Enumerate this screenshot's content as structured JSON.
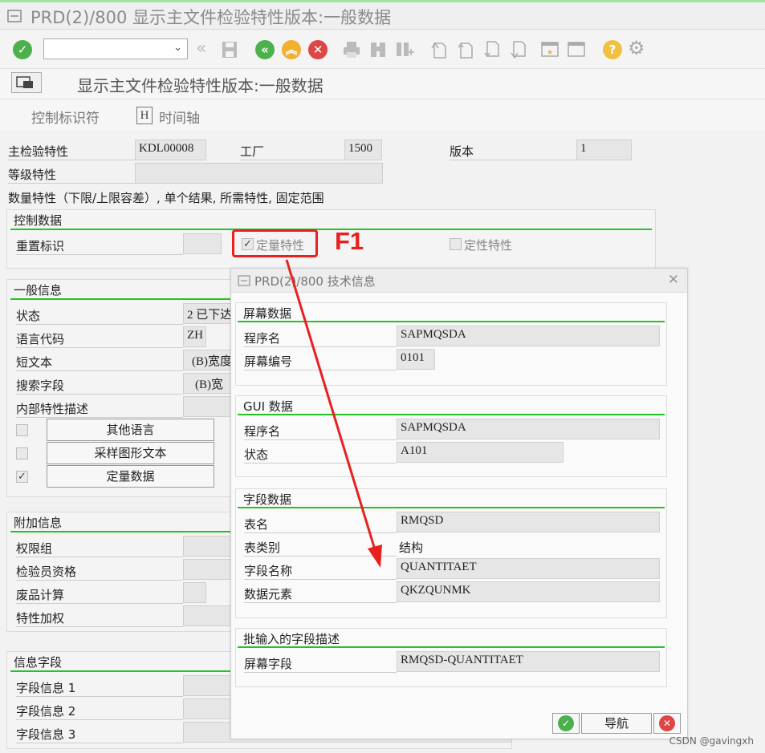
{
  "window": {
    "title": "PRD(2)/800 显示主文件检验特性版本:一般数据"
  },
  "toolbar": {
    "command_field_value": ""
  },
  "screen_title": "显示主文件检验特性版本:一般数据",
  "app_toolbar": {
    "control_indicators": "控制标识符",
    "timeline": "时间轴",
    "timeline_key": "H"
  },
  "header": {
    "master_char_label": "主检验特性",
    "master_char_value": "KDL00008",
    "plant_label": "工厂",
    "plant_value": "1500",
    "version_label": "版本",
    "version_value": "1",
    "class_char_label": "等级特性",
    "class_char_value": "",
    "description": "数量特性（下限/上限容差）, 单个结果, 所需特性, 固定范围"
  },
  "control_data": {
    "title": "控制数据",
    "reset_label": "重置标识",
    "quantitative": "定量特性",
    "quantitative_checked": true,
    "qualitative": "定性特性",
    "qualitative_checked": false
  },
  "general_info": {
    "title": "一般信息",
    "status_label": "状态",
    "status_value": "2 已下达",
    "lang_label": "语言代码",
    "lang_value": "ZH",
    "short_text_label": "短文本",
    "short_text_value": "(B)宽度",
    "search_label": "搜索字段",
    "search_value": "(B)宽",
    "internal_desc_label": "内部特性描述",
    "btn_other_lang": "其他语言",
    "btn_sample_text": "采样图形文本",
    "btn_quant_data": "定量数据",
    "quant_data_checked": true
  },
  "additional_info": {
    "title": "附加信息",
    "authority_label": "权限组",
    "inspector_label": "检验员资格",
    "scrap_label": "废品计算",
    "weighting_label": "特性加权"
  },
  "info_fields": {
    "title": "信息字段",
    "f1": "字段信息 1",
    "f2": "字段信息 2",
    "f3": "字段信息 3"
  },
  "annotation": {
    "key": "F1"
  },
  "dialog": {
    "title": "PRD(2)/800 技术信息",
    "screen_data": {
      "title": "屏幕数据",
      "program_label": "程序名",
      "program_value": "SAPMQSDA",
      "screen_no_label": "屏幕编号",
      "screen_no_value": "0101"
    },
    "gui_data": {
      "title": "GUI 数据",
      "program_label": "程序名",
      "program_value": "SAPMQSDA",
      "status_label": "状态",
      "status_value": "A101"
    },
    "field_data": {
      "title": "字段数据",
      "table_label": "表名",
      "table_value": "RMQSD",
      "table_type_label": "表类别",
      "table_type_value": "结构",
      "field_name_label": "字段名称",
      "field_name_value": "QUANTITAET",
      "data_element_label": "数据元素",
      "data_element_value": "QKZQUNMK"
    },
    "batch_input": {
      "title": "批输入的字段描述",
      "screen_field_label": "屏幕字段",
      "screen_field_value": "RMQSD-QUANTITAET"
    },
    "navigate_label": "导航"
  },
  "watermark": "CSDN @gavingxh"
}
